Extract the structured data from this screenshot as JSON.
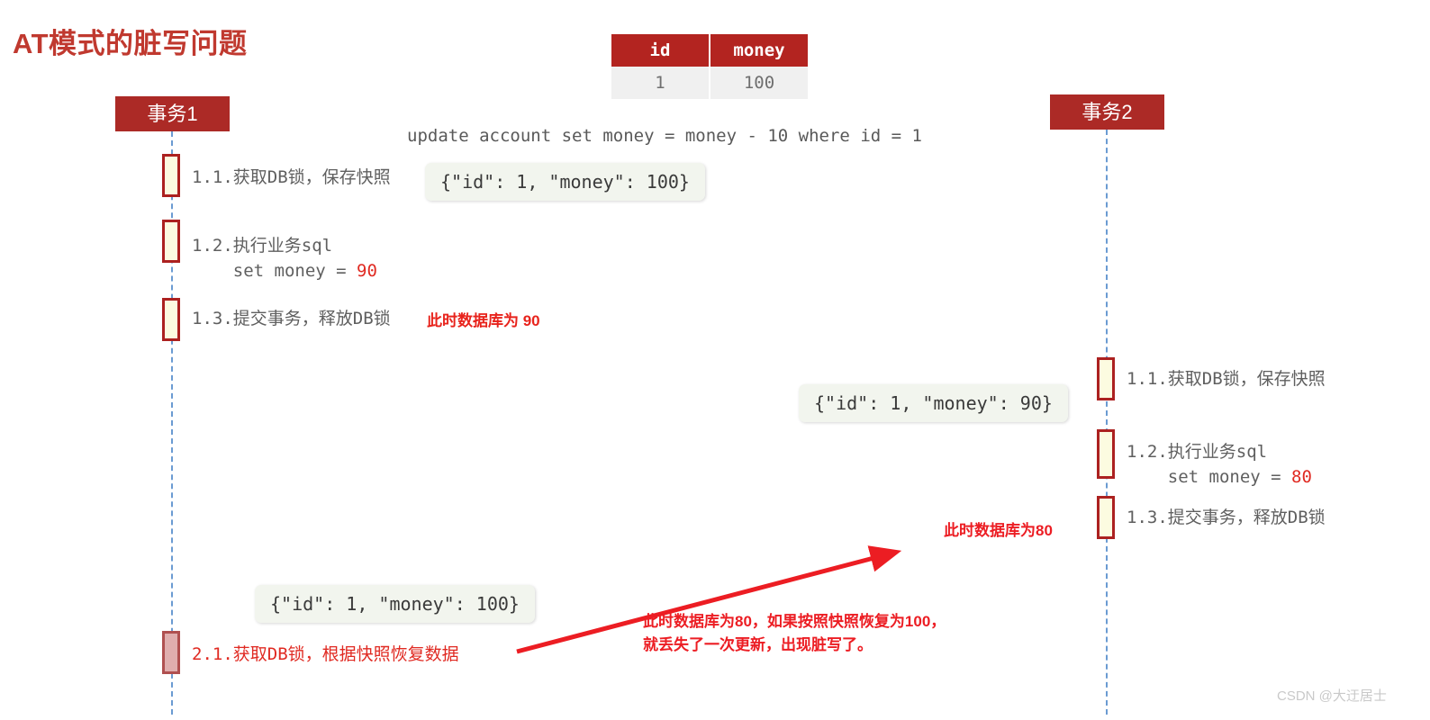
{
  "page": {
    "title": "AT模式的脏写问题",
    "title_color": "#c0392f",
    "watermark": "CSDN @大迂居士"
  },
  "account_table": {
    "headers": [
      "id",
      "money"
    ],
    "rows": [
      [
        "1",
        "100"
      ]
    ],
    "header_bg": "#b32420",
    "cell_bg": "#f0f0f0"
  },
  "sql": {
    "statement": "update account set money = money - 10 where id = 1"
  },
  "participants": [
    {
      "id": "tx1",
      "label": "事务1"
    },
    {
      "id": "tx2",
      "label": "事务2"
    }
  ],
  "steps": {
    "tx1": [
      {
        "id": "1.1",
        "text": "1.1.获取DB锁，保存快照"
      },
      {
        "id": "1.2",
        "text_line1": "1.2.执行业务sql",
        "text_line2": "    set money = ",
        "value": "90"
      },
      {
        "id": "1.3",
        "text": "1.3.提交事务，释放DB锁"
      },
      {
        "id": "2.1",
        "text": "2.1.获取DB锁，根据快照恢复数据",
        "dirty": true
      }
    ],
    "tx2": [
      {
        "id": "1.1",
        "text": "1.1.获取DB锁，保存快照"
      },
      {
        "id": "1.2",
        "text_line1": "1.2.执行业务sql",
        "text_line2": "    set money = ",
        "value": "80"
      },
      {
        "id": "1.3",
        "text": "1.3.提交事务，释放DB锁"
      }
    ]
  },
  "snapshots": [
    {
      "id": "snapshot-1",
      "text": "{\"id\": 1, \"money\": 100}"
    },
    {
      "id": "snapshot-2",
      "text": "{\"id\": 1, \"money\": 90}"
    },
    {
      "id": "snapshot-3",
      "text": "{\"id\": 1, \"money\": 100}"
    }
  ],
  "annotations": {
    "db_is_90": "此时数据库为 90",
    "db_is_80": "此时数据库为80",
    "dirty_write_explain": "此时数据库为80，如果按照快照恢复为100，\n就丢失了一次更新，出现脏写了。",
    "color": "#ec1d23"
  },
  "colors": {
    "accent_red": "#ac2a26",
    "bright_red": "#ec1d23",
    "lifeline_blue": "#6b9bd2",
    "activation_fill": "#fcfbe0",
    "activation_dirty_fill": "#e0aeae",
    "snapshot_bg": "#f2f5ee"
  }
}
